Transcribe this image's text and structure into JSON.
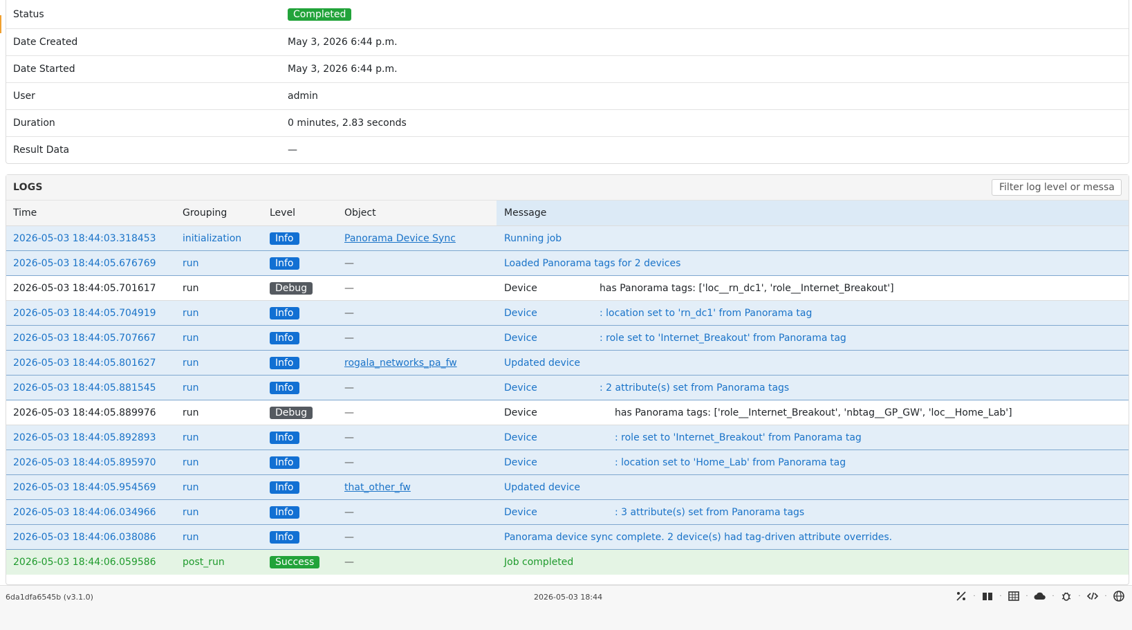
{
  "summary": {
    "status_label": "Status",
    "status_value": "Completed",
    "created_label": "Date Created",
    "created_value": "May 3, 2026 6:44 p.m.",
    "started_label": "Date Started",
    "started_value": "May 3, 2026 6:44 p.m.",
    "user_label": "User",
    "user_value": "admin",
    "duration_label": "Duration",
    "duration_value": "0 minutes, 2.83 seconds",
    "result_label": "Result Data",
    "result_value": "—"
  },
  "logs": {
    "title": "LOGS",
    "filter_placeholder": "Filter log level or message",
    "columns": {
      "time": "Time",
      "grouping": "Grouping",
      "level": "Level",
      "object": "Object",
      "message": "Message"
    },
    "rows": [
      {
        "time": "2026-05-03 18:44:03.318453",
        "grouping": "initialization",
        "level": "Info",
        "object": "Panorama Device Sync",
        "message_prefix": "",
        "message": "Running job"
      },
      {
        "time": "2026-05-03 18:44:05.676769",
        "grouping": "run",
        "level": "Info",
        "object": "—",
        "message_prefix": "",
        "message": "Loaded Panorama tags for 2 devices"
      },
      {
        "time": "2026-05-03 18:44:05.701617",
        "grouping": "run",
        "level": "Debug",
        "object": "—",
        "message_prefix": "Device",
        "message": "has Panorama tags: ['loc__rn_dc1', 'role__Internet_Breakout']"
      },
      {
        "time": "2026-05-03 18:44:05.704919",
        "grouping": "run",
        "level": "Info",
        "object": "—",
        "message_prefix": "Device",
        "message": ": location set to 'rn_dc1' from Panorama tag"
      },
      {
        "time": "2026-05-03 18:44:05.707667",
        "grouping": "run",
        "level": "Info",
        "object": "—",
        "message_prefix": "Device",
        "message": ": role set to 'Internet_Breakout' from Panorama tag"
      },
      {
        "time": "2026-05-03 18:44:05.801627",
        "grouping": "run",
        "level": "Info",
        "object": "rogala_networks_pa_fw",
        "message_prefix": "",
        "message": "Updated device"
      },
      {
        "time": "2026-05-03 18:44:05.881545",
        "grouping": "run",
        "level": "Info",
        "object": "—",
        "message_prefix": "Device",
        "message": ": 2 attribute(s) set from Panorama tags"
      },
      {
        "time": "2026-05-03 18:44:05.889976",
        "grouping": "run",
        "level": "Debug",
        "object": "—",
        "message_prefix": "Device",
        "message": "has Panorama tags: ['role__Internet_Breakout', 'nbtag__GP_GW', 'loc__Home_Lab']"
      },
      {
        "time": "2026-05-03 18:44:05.892893",
        "grouping": "run",
        "level": "Info",
        "object": "—",
        "message_prefix": "Device",
        "message": ": role set to 'Internet_Breakout' from Panorama tag"
      },
      {
        "time": "2026-05-03 18:44:05.895970",
        "grouping": "run",
        "level": "Info",
        "object": "—",
        "message_prefix": "Device",
        "message": ": location set to 'Home_Lab' from Panorama tag"
      },
      {
        "time": "2026-05-03 18:44:05.954569",
        "grouping": "run",
        "level": "Info",
        "object": "that_other_fw",
        "message_prefix": "",
        "message": "Updated device"
      },
      {
        "time": "2026-05-03 18:44:06.034966",
        "grouping": "run",
        "level": "Info",
        "object": "—",
        "message_prefix": "Device",
        "message": ": 3 attribute(s) set from Panorama tags"
      },
      {
        "time": "2026-05-03 18:44:06.038086",
        "grouping": "run",
        "level": "Info",
        "object": "—",
        "message_prefix": "",
        "message": "Panorama device sync complete. 2 device(s) had tag-driven attribute overrides."
      },
      {
        "time": "2026-05-03 18:44:06.059586",
        "grouping": "post_run",
        "level": "Success",
        "object": "—",
        "message_prefix": "",
        "message": "Job completed"
      }
    ]
  },
  "footer": {
    "version": "6da1dfa6545b (v3.1.0)",
    "timestamp": "2026-05-03 18:44",
    "icons": [
      "theme-icon",
      "docs-icon",
      "api-icon",
      "cloud-icon",
      "bug-icon",
      "code-icon",
      "globe-icon"
    ]
  },
  "colors": {
    "info_row": "#e3eef8",
    "info_text": "#1a73c8",
    "success_row": "#e4f4e4",
    "success_text": "#1e9a2c",
    "badge_info": "#1270d3",
    "badge_debug": "#555a60",
    "badge_success": "#22a33a"
  }
}
